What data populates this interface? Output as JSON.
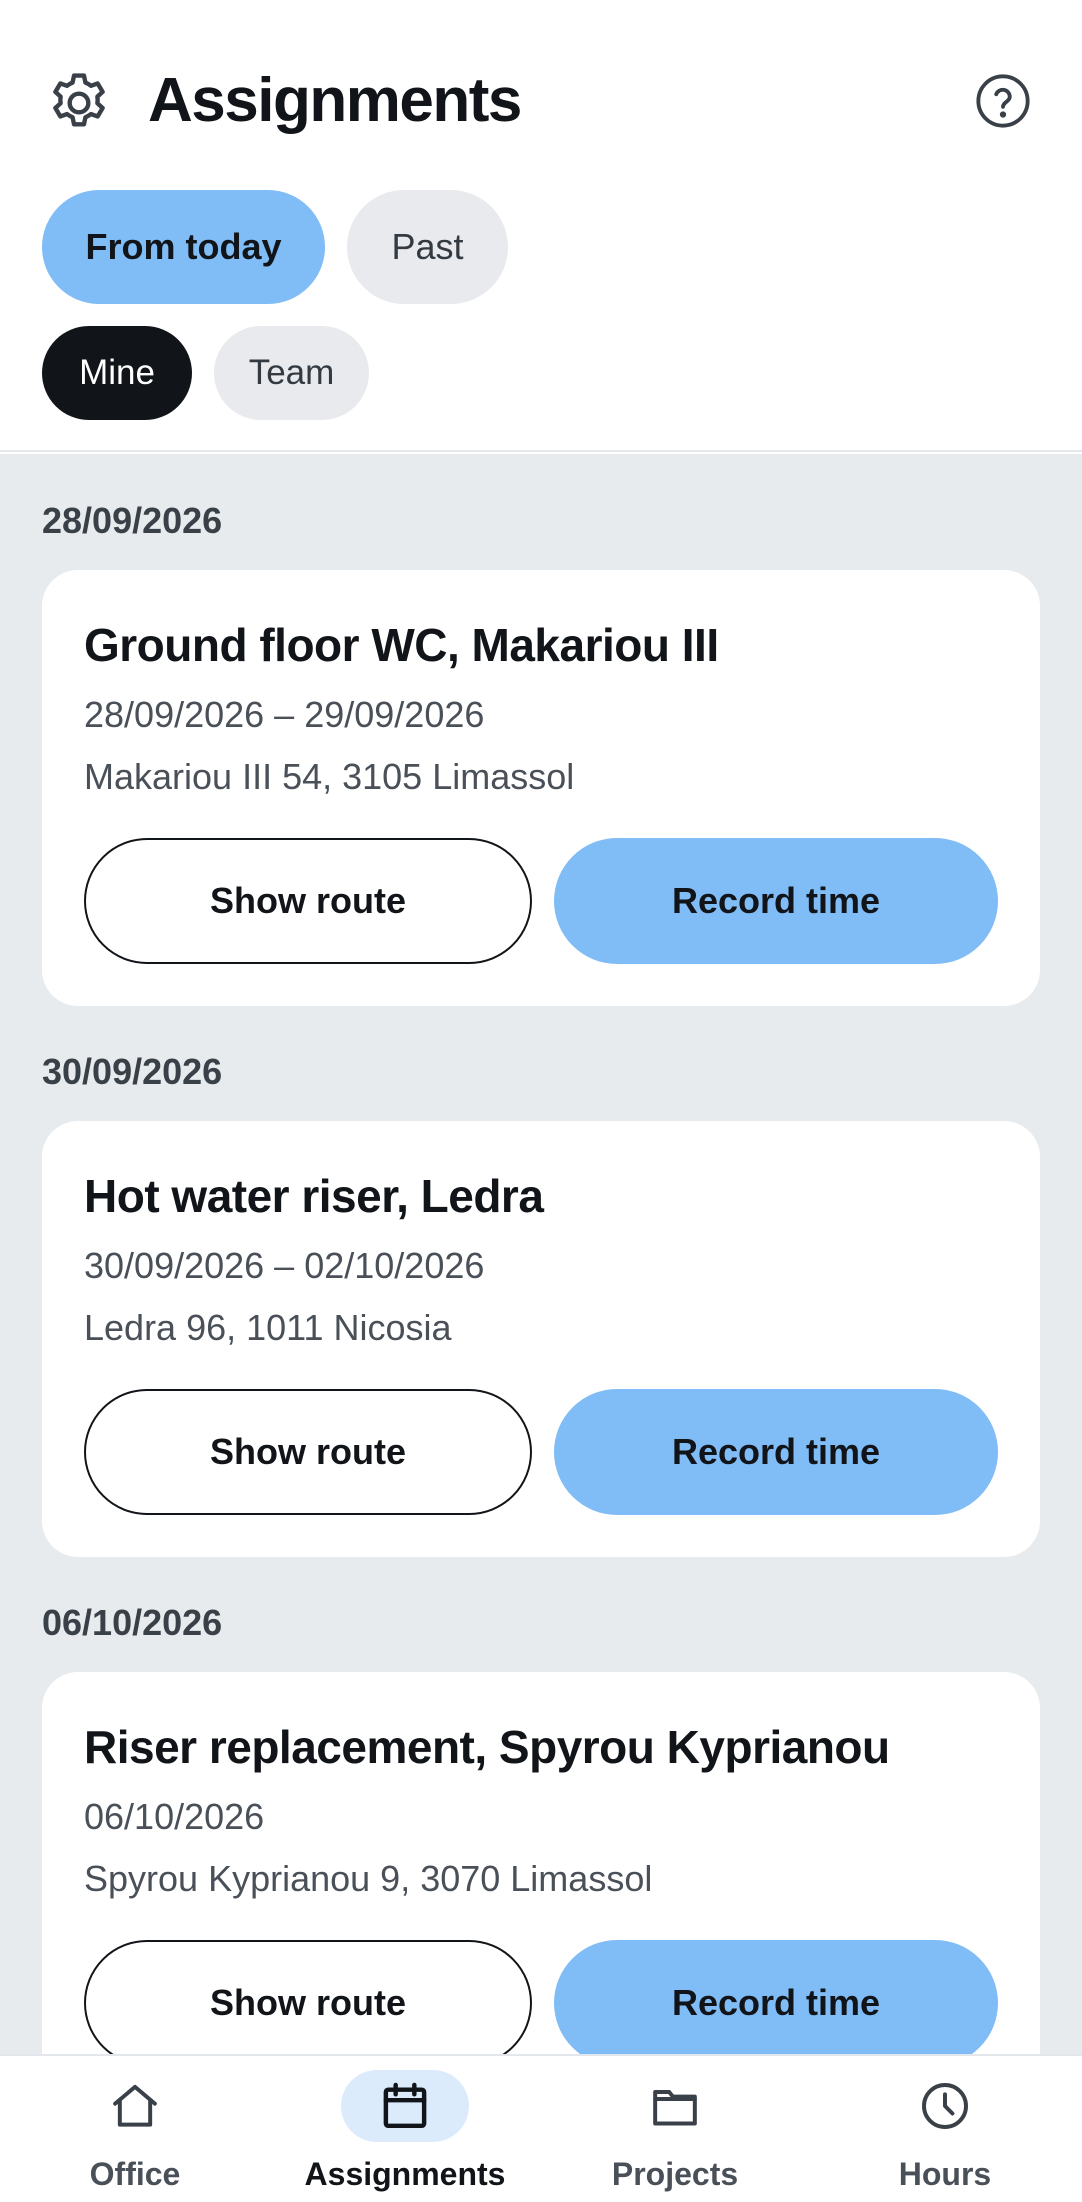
{
  "header": {
    "title": "Assignments",
    "settings_icon": "gear-icon",
    "help_icon": "question-circle-icon"
  },
  "filters": {
    "period": [
      {
        "label": "From today",
        "selected": true
      },
      {
        "label": "Past",
        "selected": false
      }
    ],
    "scope": [
      {
        "label": "Mine",
        "selected": true
      },
      {
        "label": "Team",
        "selected": false
      }
    ]
  },
  "groups": [
    {
      "date": "28/09/2026",
      "card": {
        "title": "Ground floor WC, Makariou III",
        "dates": "28/09/2026 – 29/09/2026",
        "address": "Makariou III 54, 3105 Limassol",
        "route_label": "Show route",
        "record_label": "Record time"
      }
    },
    {
      "date": "30/09/2026",
      "card": {
        "title": "Hot water riser, Ledra",
        "dates": "30/09/2026 – 02/10/2026",
        "address": "Ledra 96, 1011 Nicosia",
        "route_label": "Show route",
        "record_label": "Record time"
      }
    },
    {
      "date": "06/10/2026",
      "card": {
        "title": "Riser replacement, Spyrou Kyprianou",
        "dates": "06/10/2026",
        "address": "Spyrou Kyprianou 9, 3070 Limassol",
        "route_label": "Show route",
        "record_label": "Record time"
      }
    }
  ],
  "nav": {
    "items": [
      {
        "label": "Office",
        "icon": "home-icon",
        "active": false
      },
      {
        "label": "Assignments",
        "icon": "calendar-icon",
        "active": true
      },
      {
        "label": "Projects",
        "icon": "folder-icon",
        "active": false
      },
      {
        "label": "Hours",
        "icon": "clock-icon",
        "active": false
      }
    ]
  },
  "colors": {
    "accent": "#80bcf5",
    "active_nav_bg": "#dcebfb",
    "dark_chip": "#111418",
    "list_background": "#e8ebee"
  }
}
